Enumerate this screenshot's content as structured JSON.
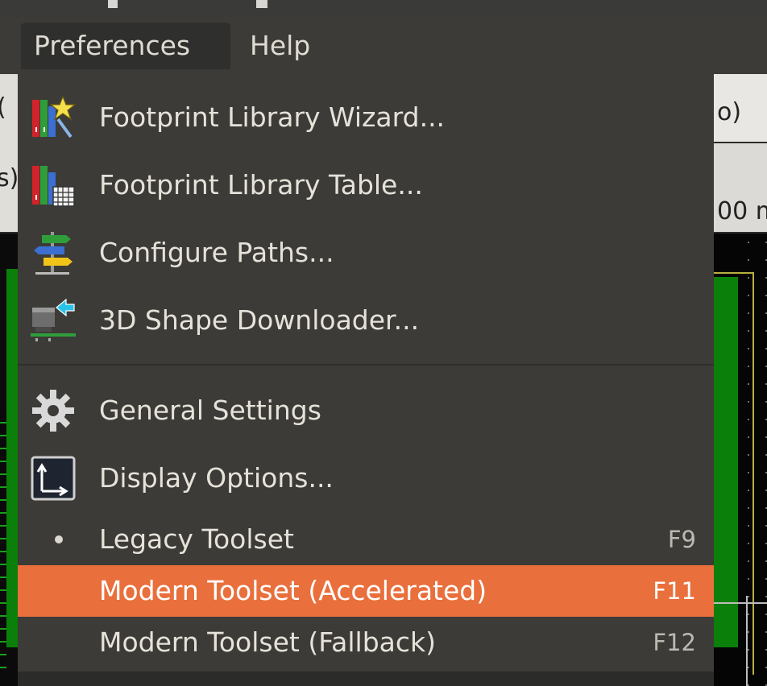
{
  "menubar": {
    "items": [
      {
        "label": "Preferences",
        "active": true
      },
      {
        "label": "Help",
        "active": false
      }
    ]
  },
  "background": {
    "row1_text": "o)",
    "row2_text": "00 m",
    "left_text": "s)"
  },
  "menu": {
    "groups": [
      [
        {
          "label": "Footprint Library Wizard...",
          "icon": "library-wizard-icon"
        },
        {
          "label": "Footprint Library Table...",
          "icon": "library-table-icon"
        },
        {
          "label": "Configure Paths...",
          "icon": "signpost-icon"
        },
        {
          "label": "3D Shape Downloader...",
          "icon": "3d-download-icon"
        }
      ],
      [
        {
          "label": "General Settings",
          "icon": "gear-icon"
        },
        {
          "label": "Display Options...",
          "icon": "display-options-icon"
        },
        {
          "label": "Legacy Toolset",
          "shortcut": "F9",
          "selected": true
        },
        {
          "label": "Modern Toolset (Accelerated)",
          "shortcut": "F11",
          "highlighted": true
        },
        {
          "label": "Modern Toolset (Fallback)",
          "shortcut": "F12"
        }
      ]
    ]
  },
  "colors": {
    "menu_bg": "#3c3b37",
    "highlight": "#e96f3c",
    "text": "#e6e2da"
  }
}
